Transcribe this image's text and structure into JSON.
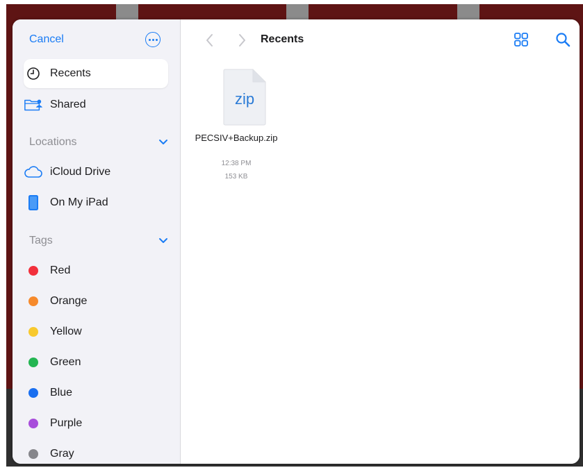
{
  "sidebar": {
    "cancel_label": "Cancel",
    "more_icon": "ellipsis-circle-icon",
    "favorites": [
      {
        "label": "Recents",
        "icon": "clock-icon",
        "selected": true
      },
      {
        "label": "Shared",
        "icon": "shared-folder-icon",
        "selected": false
      }
    ],
    "locations": {
      "header": "Locations",
      "items": [
        {
          "label": "iCloud Drive",
          "icon": "cloud-icon"
        },
        {
          "label": "On My iPad",
          "icon": "ipad-icon"
        }
      ]
    },
    "tags": {
      "header": "Tags",
      "items": [
        {
          "label": "Red",
          "color": "#f2303c"
        },
        {
          "label": "Orange",
          "color": "#f68a2c"
        },
        {
          "label": "Yellow",
          "color": "#f8c92e"
        },
        {
          "label": "Green",
          "color": "#24b552"
        },
        {
          "label": "Blue",
          "color": "#1a6ff0"
        },
        {
          "label": "Purple",
          "color": "#a84ddb"
        },
        {
          "label": "Gray",
          "color": "#86868b"
        }
      ]
    }
  },
  "main": {
    "title": "Recents",
    "file": {
      "icon_text": "zip",
      "name": "PECSIV+Backup.zip",
      "time": "12:38 PM",
      "size": "153 KB"
    }
  },
  "colors": {
    "accent": "#1a7cf5",
    "sidebar_bg": "#f2f2f7",
    "secondary_text": "#8e8e93"
  }
}
